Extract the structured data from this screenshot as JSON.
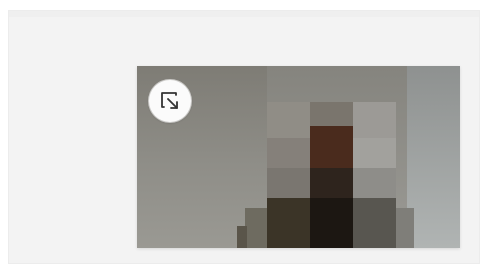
{
  "picture_in_picture": {
    "content": "pixelated-video-frame",
    "control": {
      "icon": "exit-picture-in-picture-icon",
      "color": "#ffffff"
    }
  },
  "colors": {
    "window_background": "#f3f3f3",
    "wall": "#8b8a84",
    "control_background": "#fbfbfb",
    "icon_stroke": "#333333"
  }
}
